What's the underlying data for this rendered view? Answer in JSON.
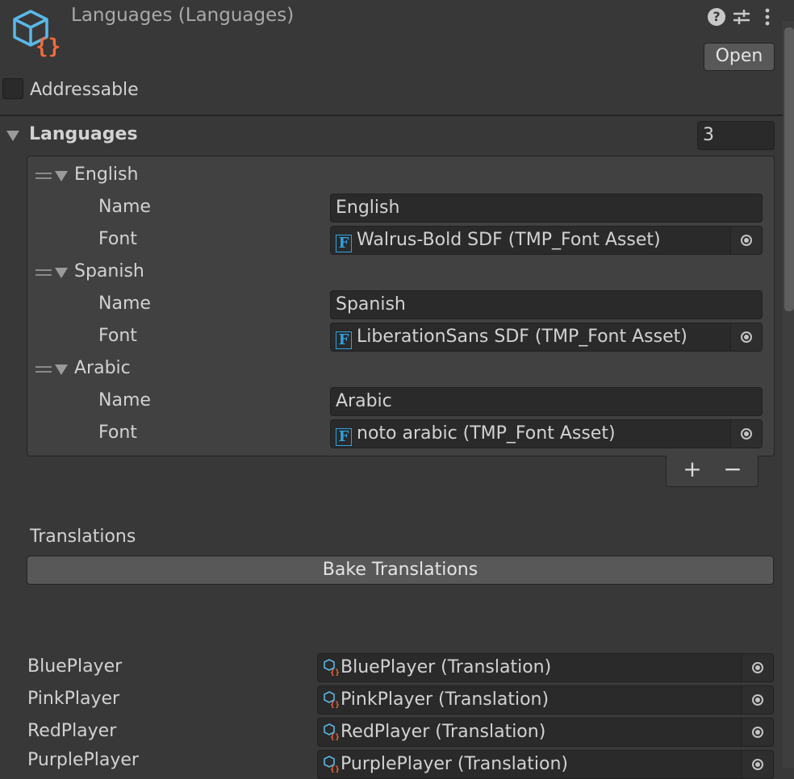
{
  "header": {
    "title": "Languages (Languages)",
    "open_label": "Open",
    "addressable_label": "Addressable",
    "addressable_checked": false
  },
  "languages": {
    "label": "Languages",
    "count": "3",
    "items": [
      {
        "header": "English",
        "name_label": "Name",
        "name_value": "English",
        "font_label": "Font",
        "font_value": "Walrus-Bold SDF (TMP_Font Asset)"
      },
      {
        "header": "Spanish",
        "name_label": "Name",
        "name_value": "Spanish",
        "font_label": "Font",
        "font_value": "LiberationSans SDF (TMP_Font Asset)"
      },
      {
        "header": "Arabic",
        "name_label": "Name",
        "name_value": "Arabic",
        "font_label": "Font",
        "font_value": "noto arabic (TMP_Font Asset)"
      }
    ],
    "add_label": "+",
    "remove_label": "−"
  },
  "translations": {
    "label": "Translations",
    "bake_label": "Bake Translations"
  },
  "players": [
    {
      "label": "BluePlayer",
      "value": "BluePlayer (Translation)"
    },
    {
      "label": "PinkPlayer",
      "value": "PinkPlayer (Translation)"
    },
    {
      "label": "RedPlayer",
      "value": "RedPlayer (Translation)"
    },
    {
      "label": "PurplePlayer",
      "value": "PurplePlayer (Translation)"
    }
  ],
  "icons": {
    "asset": "scriptable-asset-icon",
    "help": "help-icon",
    "settings": "sliders-icon",
    "menu": "kebab-menu-icon",
    "font": "font-asset-icon",
    "translation": "translation-asset-icon",
    "picker": "object-picker-icon"
  },
  "colors": {
    "background": "#383838",
    "field": "#2a2a2a",
    "asset_cube": "#5ab8e8",
    "asset_braces": "#f26a3d",
    "font_icon": "#2fa2e0"
  }
}
